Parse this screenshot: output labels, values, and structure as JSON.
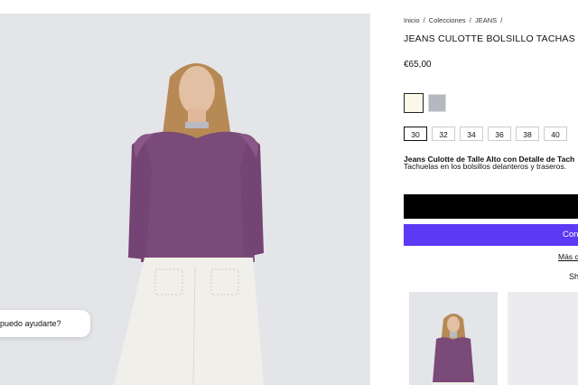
{
  "chat": {
    "bubble_text": "puedo ayudarte?"
  },
  "breadcrumb": [
    "Inicio",
    "/",
    "Colecciones",
    "/",
    "JEANS",
    "/"
  ],
  "product": {
    "title": "JEANS CULOTTE BOLSILLO TACHAS",
    "price": "€65,00",
    "colors": [
      "#fbf8ea",
      "#b6b8c0"
    ],
    "sizes": [
      "30",
      "32",
      "34",
      "36",
      "38",
      "40"
    ],
    "selected_size": "30",
    "description_bold": "Jeans Culotte de Talle Alto con Detalle de Tach",
    "description": "Tachuelas en los bolsillos delanteros y traseros."
  },
  "actions": {
    "add_button_label": "",
    "buy_button_label": "Con",
    "more_link": "Más c"
  },
  "share_label": "Sh",
  "colors": {
    "accent": "#5b39f5",
    "hero_bg": "#e4e5e9",
    "sweater": "#7a4a78"
  }
}
